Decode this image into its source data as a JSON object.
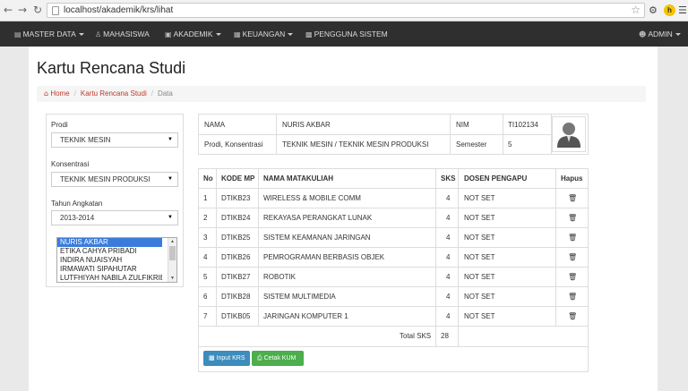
{
  "browser": {
    "url": "localhost/akademik/krs/lihat"
  },
  "navbar": {
    "items": [
      {
        "label": "MASTER DATA",
        "icon": "list-icon"
      },
      {
        "label": "MAHASISWA",
        "icon": "users-icon"
      },
      {
        "label": "AKADEMIK",
        "icon": "book-icon"
      },
      {
        "label": "KEUANGAN",
        "icon": "money-icon"
      },
      {
        "label": "PENGGUNA SISTEM",
        "icon": "user-settings-icon"
      }
    ],
    "user_label": "ADMIN"
  },
  "page": {
    "title": "Kartu Rencana Studi",
    "breadcrumb": [
      "Home",
      "Kartu Rencana Studi",
      "Data"
    ]
  },
  "filter": {
    "prodi_label": "Prodi",
    "prodi_value": "TEKNIK MESIN",
    "konsentrasi_label": "Konsentrasi",
    "konsentrasi_value": "TEKNIK MESIN PRODUKSI",
    "tahun_label": "Tahun Angkatan",
    "tahun_value": "2013-2014",
    "students": [
      "NURIS AKBAR",
      "ETIKA CAHYA PRIBADI",
      "INDIRA NUAISYAH",
      "IRMAWATI SIPAHUTAR",
      "LUTFHIYAH NABILA ZULFIKRIE"
    ]
  },
  "info": {
    "nama_label": "NAMA",
    "nama_value": "NURIS AKBAR",
    "nim_label": "NIM",
    "nim_value": "TI102134",
    "prodi_label": "Prodi, Konsentrasi",
    "prodi_value": "TEKNIK MESIN / TEKNIK MESIN PRODUKSI",
    "semester_label": "Semester",
    "semester_value": "5"
  },
  "krs": {
    "headers": [
      "No",
      "KODE MP",
      "NAMA MATAKULIAH",
      "SKS",
      "DOSEN PENGAPU",
      "Hapus"
    ],
    "rows": [
      {
        "no": "1",
        "kode": "DTIKB23",
        "nama": "WIRELESS & MOBILE COMM",
        "sks": "4",
        "dosen": "NOT SET"
      },
      {
        "no": "2",
        "kode": "DTIKB24",
        "nama": "REKAYASA PERANGKAT LUNAK",
        "sks": "4",
        "dosen": "NOT SET"
      },
      {
        "no": "3",
        "kode": "DTIKB25",
        "nama": "SISTEM KEAMANAN JARINGAN",
        "sks": "4",
        "dosen": "NOT SET"
      },
      {
        "no": "4",
        "kode": "DTIKB26",
        "nama": "PEMROGRAMAN BERBASIS OBJEK",
        "sks": "4",
        "dosen": "NOT SET"
      },
      {
        "no": "5",
        "kode": "DTIKB27",
        "nama": "ROBOTIK",
        "sks": "4",
        "dosen": "NOT SET"
      },
      {
        "no": "6",
        "kode": "DTIKB28",
        "nama": "SISTEM MULTIMEDIA",
        "sks": "4",
        "dosen": "NOT SET"
      },
      {
        "no": "7",
        "kode": "DTIKB05",
        "nama": "JARINGAN KOMPUTER 1",
        "sks": "4",
        "dosen": "NOT SET"
      }
    ],
    "total_label": "Total SKS",
    "total_value": "28",
    "input_button": "Input KRS",
    "cetak_button": "Cetak KUM"
  }
}
